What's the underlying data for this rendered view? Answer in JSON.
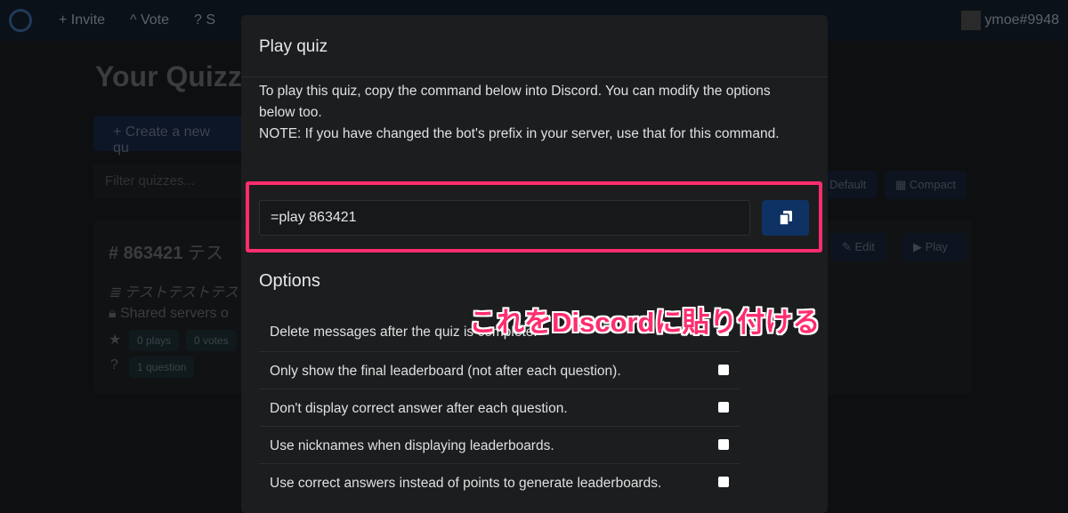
{
  "nav": {
    "items": [
      "+ Invite",
      "^ Vote",
      "? S"
    ],
    "user": "ymoe#9948"
  },
  "background": {
    "title": "Your Quizzes",
    "create": "+ Create a new qu",
    "filter_placeholder": "Filter quizzes...",
    "view_default": "Default",
    "view_compact": "Compact",
    "quiz": {
      "id": "# 863421",
      "name": "テス",
      "description": "テストテストテス",
      "sharing": "Shared servers o",
      "plays": "0 plays",
      "votes": "0 votes",
      "questions": "1 question",
      "edit": "Edit",
      "play": "Play"
    }
  },
  "modal": {
    "title": "Play quiz",
    "description_1": "To play this quiz, copy the command below into Discord. You can modify the options below too.",
    "description_2": "NOTE: If you have changed the bot's prefix in your server, use that for this command.",
    "command": "=play 863421",
    "options_heading": "Options",
    "options": [
      {
        "label": "Delete messages after the quiz is complete.",
        "checked": false
      },
      {
        "label": "Only show the final leaderboard (not after each question).",
        "checked": false
      },
      {
        "label": "Don't display correct answer after each question.",
        "checked": false
      },
      {
        "label": "Use nicknames when displaying leaderboards.",
        "checked": false
      },
      {
        "label": "Use correct answers instead of points to generate leaderboards.",
        "checked": false
      }
    ]
  },
  "annotation": "これをDiscordに貼り付ける",
  "colors": {
    "highlight": "#ff2d6e",
    "copy_button": "#0e3263"
  }
}
